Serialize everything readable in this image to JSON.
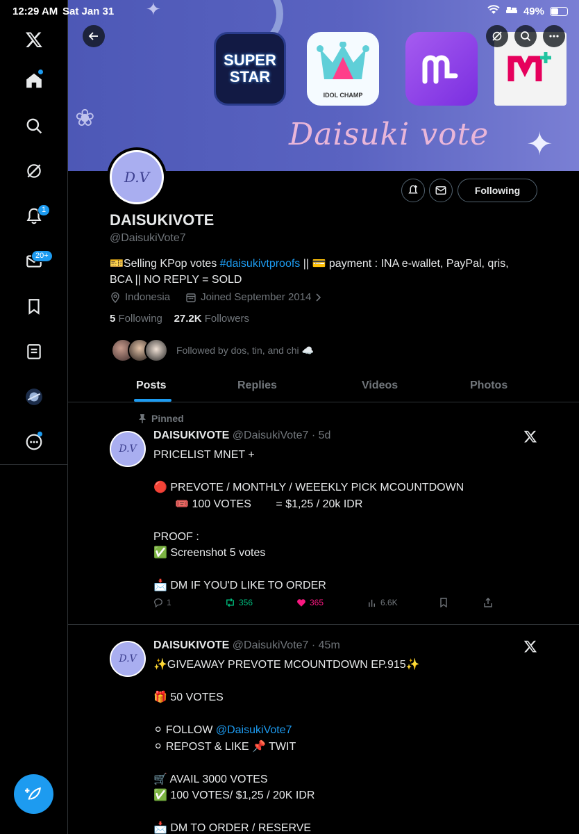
{
  "status": {
    "time": "12:29 AM",
    "date": "Sat Jan 31",
    "battery": "49%",
    "battery_level": 0.49
  },
  "sidebar": {
    "badges": {
      "notifications": "1",
      "messages": "20+"
    }
  },
  "banner": {
    "tile_superstar": "SUPER STAR",
    "tile_idolchamp": "IDOL CHAMP",
    "title": "Daisuki vote"
  },
  "profile": {
    "avatar_initials": "D.V",
    "name": "DAISUKIVOTE",
    "handle": "@DaisukiVote7",
    "bio_prefix": "🎫Selling KPop votes ",
    "bio_hashtag": "#daisukivtproofs",
    "bio_suffix": " || 💳 payment : INA e-wallet, PayPal, qris, BCA || NO REPLY = SOLD",
    "location": "Indonesia",
    "joined": "Joined September 2014",
    "following_count": "5",
    "following_label": "Following",
    "followers_count": "27.2K",
    "followers_label": "Followers",
    "followed_by": "Followed by dos, tin, and chi ☁️",
    "follow_button": "Following"
  },
  "tabs": [
    "Posts",
    "Replies",
    "Videos",
    "Photos"
  ],
  "posts": [
    {
      "pinned_label": "Pinned",
      "name": "DAISUKIVOTE",
      "meta": "@DaisukiVote7 · 5d",
      "body": "PRICELIST MNET +\n\n🔴 PREVOTE / MONTHLY / WEEEKLY PICK MCOUNTDOWN\n       🎟️ 100 VOTES        = $1,25 / 20k IDR\n\nPROOF :\n✅ Screenshot 5 votes\n\n📩 DM IF YOU'D LIKE TO ORDER",
      "replies": "1",
      "reposts": "356",
      "likes": "365",
      "views": "6.6K"
    },
    {
      "name": "DAISUKIVOTE",
      "meta": "@DaisukiVote7 · 45m",
      "line1": "✨GIVEAWAY PREVOTE MCOUNTDOWN EP.915✨",
      "line2": "🎁 50 VOTES",
      "line3_prefix": "⚪ FOLLOW ",
      "line3_mention": "@DaisukiVote7",
      "line4": "⚪ REPOST & LIKE 📌 TWIT",
      "line5": "🛒 AVAIL 3000 VOTES",
      "line6": "✅ 100 VOTES/ $1,25 / 20K IDR",
      "line7": "📩 DM TO ORDER / RESERVE"
    }
  ]
}
